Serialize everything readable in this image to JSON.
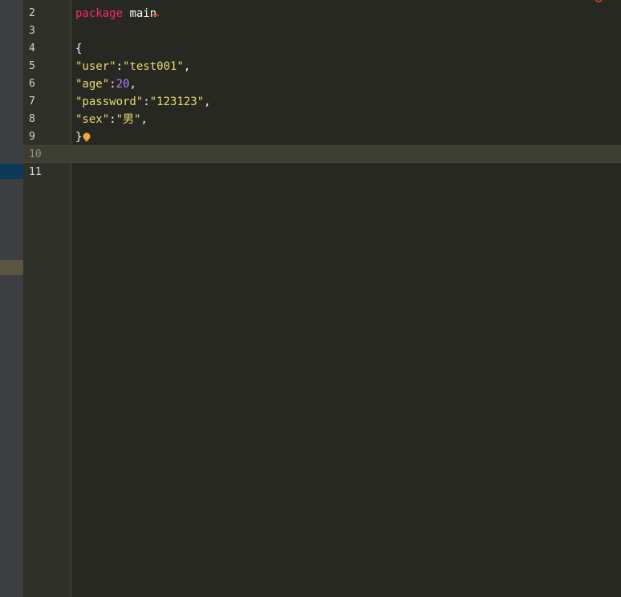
{
  "editor": {
    "gutter": {
      "line_numbers": [
        "2",
        "3",
        "4",
        "5",
        "6",
        "7",
        "8",
        "9",
        "10",
        "11"
      ],
      "current_line": "10"
    },
    "code": {
      "line2": {
        "keyword": "package",
        "space": " ",
        "name": "main"
      },
      "line4": {
        "text": "{"
      },
      "line5": {
        "key": "\"user\"",
        "colon": ":",
        "value": "\"test001\"",
        "comma": ","
      },
      "line6": {
        "key": "\"age\"",
        "colon": ":",
        "value": "20",
        "comma": ","
      },
      "line7": {
        "key": "\"password\"",
        "colon": ":",
        "value": "\"123123\"",
        "comma": ","
      },
      "line8": {
        "key": "\"sex\"",
        "colon": ":",
        "value": "\"男\"",
        "comma": ","
      },
      "line9": {
        "text": "}"
      }
    },
    "colors": {
      "background": "#272822",
      "keyword": "#f92672",
      "string": "#e6db74",
      "number": "#ae81ff",
      "text": "#f8f8f2",
      "current_line": "#3e3d32",
      "error_squiggle": "#e0412b",
      "bulb": "#f2a93b"
    },
    "icons": [
      "lightbulb-icon",
      "error-squiggle",
      "status-indicator-icon"
    ]
  }
}
